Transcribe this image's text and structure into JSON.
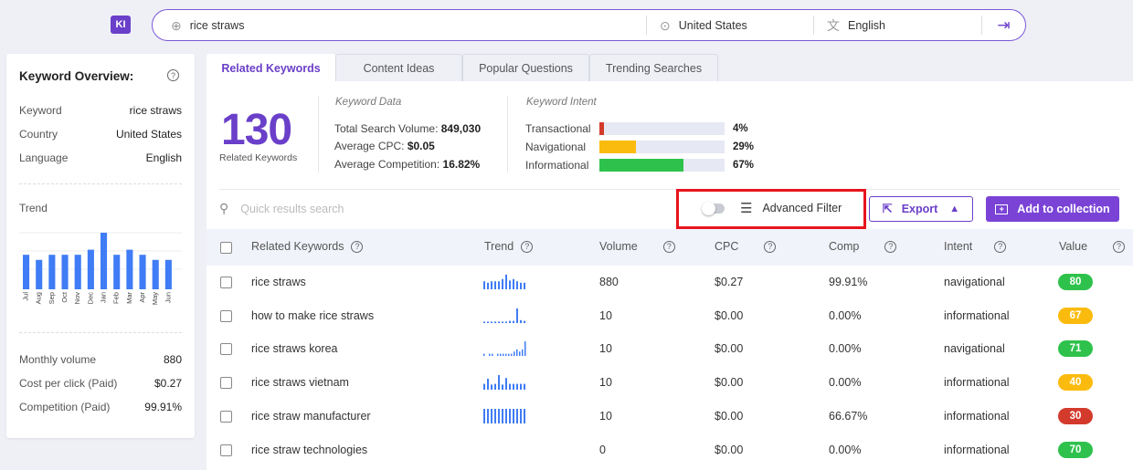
{
  "logo": "KI",
  "search": {
    "keyword": "rice straws",
    "country": "United States",
    "language": "English"
  },
  "overview": {
    "title": "Keyword Overview:",
    "keyword_label": "Keyword",
    "keyword_value": "rice straws",
    "country_label": "Country",
    "country_value": "United States",
    "language_label": "Language",
    "language_value": "English",
    "trend_label": "Trend",
    "trend_months": [
      "Jul",
      "Aug",
      "Sep",
      "Oct",
      "Nov",
      "Dec",
      "Jan",
      "Feb",
      "Mar",
      "Apr",
      "May",
      "Jun"
    ],
    "trend_values": [
      0.61,
      0.52,
      0.61,
      0.61,
      0.61,
      0.7,
      1.0,
      0.61,
      0.7,
      0.61,
      0.52,
      0.52
    ],
    "monthly_label": "Monthly volume",
    "monthly_value": "880",
    "cpc_label": "Cost per click (Paid)",
    "cpc_value": "$0.27",
    "comp_label": "Competition (Paid)",
    "comp_value": "99.91%"
  },
  "tabs": [
    "Related Keywords",
    "Content Ideas",
    "Popular Questions",
    "Trending Searches"
  ],
  "summary": {
    "count": "130",
    "count_label": "Related Keywords",
    "data_title": "Keyword Data",
    "volume_label": "Total Search Volume:",
    "volume_value": "849,030",
    "cpc_label": "Average CPC:",
    "cpc_value": "$0.05",
    "comp_label": "Average Competition:",
    "comp_value": "16.82%",
    "intent_title": "Keyword Intent",
    "intents": [
      {
        "label": "Transactional",
        "pct": "4%",
        "fraction": 0.04,
        "color": "#d33a2c"
      },
      {
        "label": "Navigational",
        "pct": "29%",
        "fraction": 0.29,
        "color": "#fbbb0e"
      },
      {
        "label": "Informational",
        "pct": "67%",
        "fraction": 0.67,
        "color": "#2ec24c"
      }
    ]
  },
  "toolbar": {
    "search_placeholder": "Quick results search",
    "advanced_filter": "Advanced Filter",
    "export": "Export",
    "add_collection": "Add to collection"
  },
  "table": {
    "headers": [
      "Related Keywords",
      "Trend",
      "Volume",
      "CPC",
      "Comp",
      "Intent",
      "Value"
    ],
    "rows": [
      {
        "keyword": "rice straws",
        "volume": "880",
        "cpc": "$0.27",
        "comp": "99.91%",
        "intent": "navigational",
        "value": "80",
        "color": "#2ec24c",
        "trend": [
          0.55,
          0.45,
          0.55,
          0.55,
          0.55,
          0.7,
          1.0,
          0.6,
          0.7,
          0.55,
          0.45,
          0.45
        ]
      },
      {
        "keyword": "how to make rice straws",
        "volume": "10",
        "cpc": "$0.00",
        "comp": "0.00%",
        "intent": "informational",
        "value": "67",
        "color": "#fbbb0e",
        "trend": [
          0.1,
          0.1,
          0.1,
          0.1,
          0.1,
          0.1,
          0.1,
          0.15,
          0.15,
          1.0,
          0.2,
          0.15
        ]
      },
      {
        "keyword": "rice straws korea",
        "volume": "10",
        "cpc": "$0.00",
        "comp": "0.00%",
        "intent": "navigational",
        "value": "71",
        "color": "#2ec24c",
        "trend": [
          0.15,
          0,
          0.15,
          0.15,
          0,
          0.15,
          0.15,
          0.15,
          0.15,
          0.15,
          0.15,
          0.3,
          0.45,
          0.3,
          0.45,
          1.0
        ]
      },
      {
        "keyword": "rice straws vietnam",
        "volume": "10",
        "cpc": "$0.00",
        "comp": "0.00%",
        "intent": "informational",
        "value": "40",
        "color": "#fbbb0e",
        "trend": [
          0.4,
          0.75,
          0.35,
          0.4,
          1.0,
          0.35,
          0.8,
          0.4,
          0.4,
          0.4,
          0.4,
          0.4
        ]
      },
      {
        "keyword": "rice straw manufacturer",
        "volume": "10",
        "cpc": "$0.00",
        "comp": "66.67%",
        "intent": "informational",
        "value": "30",
        "color": "#d33a2c",
        "trend": [
          1,
          1,
          1,
          1,
          1,
          1,
          1,
          1,
          1,
          1,
          1,
          1
        ]
      },
      {
        "keyword": "rice straw technologies",
        "volume": "0",
        "cpc": "$0.00",
        "comp": "0.00%",
        "intent": "informational",
        "value": "70",
        "color": "#2ec24c",
        "trend": []
      }
    ]
  }
}
